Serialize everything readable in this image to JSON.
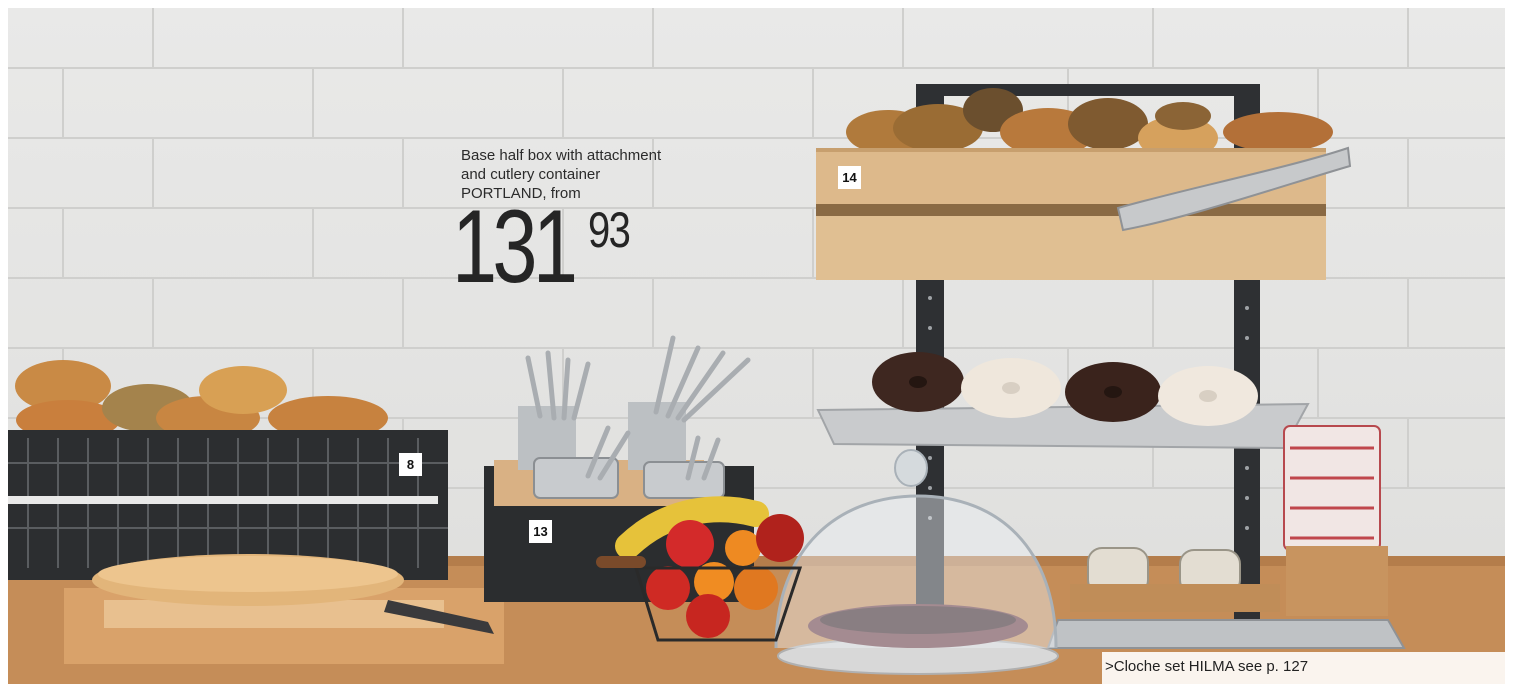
{
  "caption": {
    "line1": "Base half box with attachment",
    "line2": "and cutlery container",
    "line3": "PORTLAND, from"
  },
  "price": {
    "integer": "131",
    "decimal": "93"
  },
  "item_tags": {
    "bread_basket": "8",
    "cutlery_stand": "13",
    "tiered_rack": "14"
  },
  "cross_reference": ">Cloche set HILMA see p. 127",
  "colors": {
    "wall": "#e6e6e4",
    "table_wood": "#c9905a",
    "crate_wood": "#ddb98b",
    "metal_dark": "#2e3033"
  }
}
